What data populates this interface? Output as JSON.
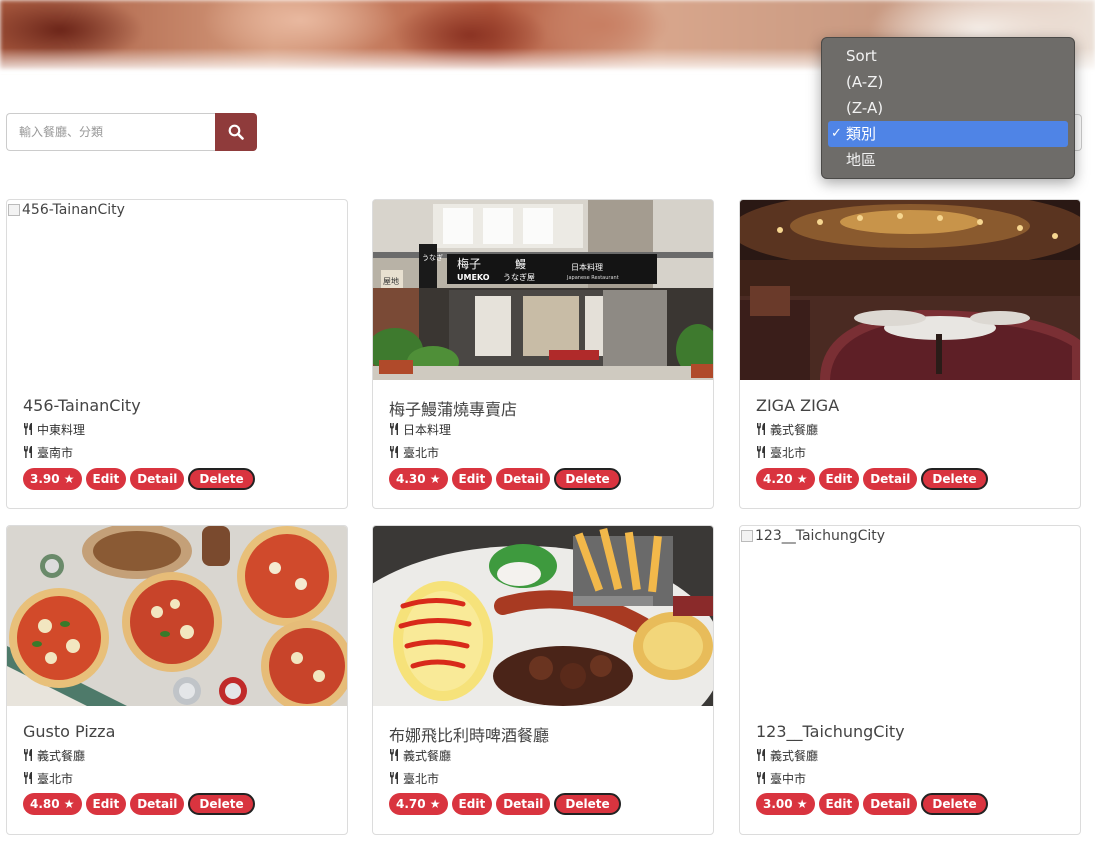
{
  "search": {
    "placeholder": "輸入餐廳、分類",
    "button_icon": "search-icon"
  },
  "sort_dropdown": {
    "options": [
      "Sort",
      "(A-Z)",
      "(Z-A)",
      "類別",
      "地區"
    ],
    "selected": "類別",
    "highlight_color": "#4f84e6"
  },
  "restaurants": [
    {
      "name": "456-TainanCity",
      "image_alt": "456-TainanCity",
      "category": "中東料理",
      "location": "臺南市",
      "rating": "3.90 ★",
      "edit": "Edit",
      "detail": "Detail",
      "delete": "Delete"
    },
    {
      "name": "梅子鰻蒲燒專賣店",
      "category": "日本料理",
      "location": "臺北市",
      "rating": "4.30 ★",
      "edit": "Edit",
      "detail": "Detail",
      "delete": "Delete",
      "sign": {
        "brand": "梅子",
        "eel": "鰻",
        "jp_title": "日本料理",
        "romaji": "UMEKO",
        "kana": "うなぎ屋",
        "subtitle": "Japanese Restaurant",
        "side_sign": "うなぎ",
        "left_sign": "屋地"
      }
    },
    {
      "name": "ZIGA ZIGA",
      "category": "義式餐廳",
      "location": "臺北市",
      "rating": "4.20 ★",
      "edit": "Edit",
      "detail": "Detail",
      "delete": "Delete"
    },
    {
      "name": "Gusto Pizza",
      "category": "義式餐廳",
      "location": "臺北市",
      "rating": "4.80 ★",
      "edit": "Edit",
      "detail": "Detail",
      "delete": "Delete"
    },
    {
      "name": "布娜飛比利時啤酒餐廳",
      "category": "義式餐廳",
      "location": "臺北市",
      "rating": "4.70 ★",
      "edit": "Edit",
      "detail": "Detail",
      "delete": "Delete"
    },
    {
      "name": "123__TaichungCity",
      "image_alt": "123__TaichungCity",
      "category": "義式餐廳",
      "location": "臺中市",
      "rating": "3.00 ★",
      "edit": "Edit",
      "detail": "Detail",
      "delete": "Delete"
    }
  ],
  "colors": {
    "badge": "#d9343f",
    "search_button": "#8f3b3b"
  }
}
